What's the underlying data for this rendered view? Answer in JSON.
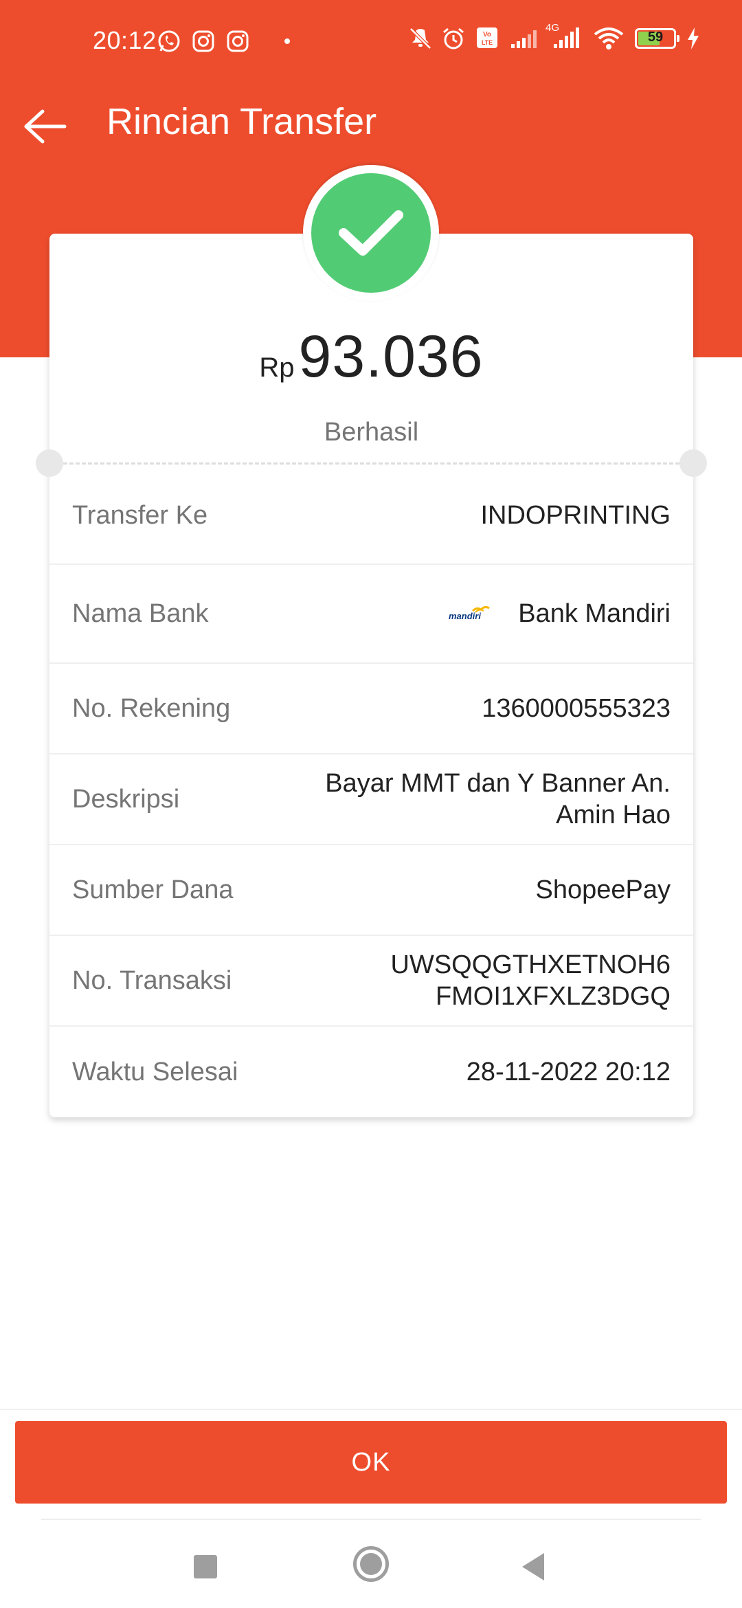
{
  "status_bar": {
    "time": "20:12",
    "battery_level": "59",
    "network_label": "4G",
    "left_icons": [
      "whatsapp-icon",
      "instagram-icon",
      "instagram-icon",
      "dot"
    ],
    "right_icons": [
      "vibrate-off-icon",
      "alarm-icon",
      "volte-icon",
      "signal-icon",
      "signal-4g-icon",
      "wifi-icon",
      "battery-icon",
      "charging-icon"
    ]
  },
  "app_bar": {
    "title": "Rincian Transfer"
  },
  "summary": {
    "currency": "Rp",
    "amount": "93.036",
    "status": "Berhasil"
  },
  "details": {
    "transfer_to": {
      "label": "Transfer Ke",
      "value": "INDOPRINTING"
    },
    "bank_name": {
      "label": "Nama Bank",
      "value": "Bank Mandiri",
      "logo_text": "mandiri"
    },
    "account_number": {
      "label": "No. Rekening",
      "value": "1360000555323"
    },
    "description": {
      "label": "Deskripsi",
      "value_line1": "Bayar MMT dan Y Banner An.",
      "value_line2": "Amin Hao"
    },
    "source_of_funds": {
      "label": "Sumber Dana",
      "value": "ShopeePay"
    },
    "transaction_number": {
      "label": "No. Transaksi",
      "value_line1": "UWSQQGTHXETNOH6",
      "value_line2": "FMOI1XFXLZ3DGQ"
    },
    "completed_time": {
      "label": "Waktu Selesai",
      "value": "28-11-2022 20:12"
    }
  },
  "actions": {
    "ok_label": "OK"
  },
  "colors": {
    "brand": "#ee4d2d",
    "success": "#52cc74",
    "label_text": "#757575",
    "value_text": "#222222"
  }
}
